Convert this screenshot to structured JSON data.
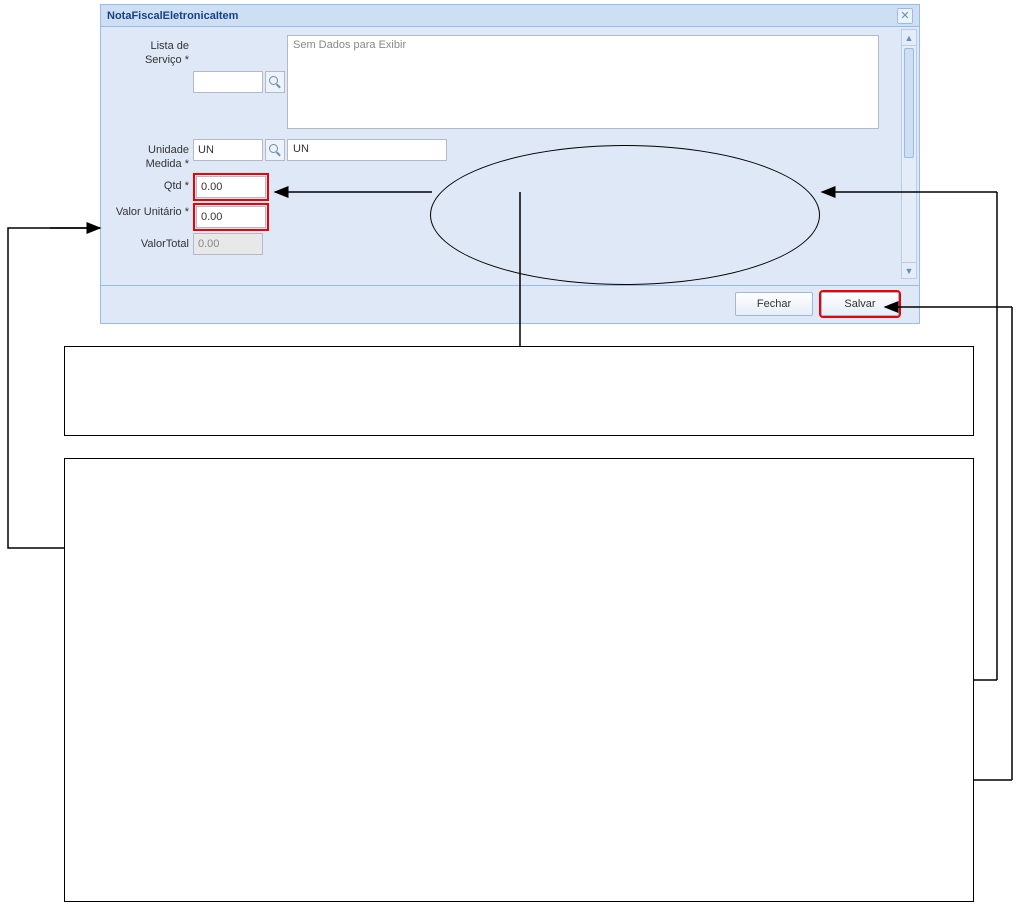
{
  "window": {
    "title": "NotaFiscalEletronicaItem"
  },
  "form": {
    "lista_servico": {
      "label": "Lista de Serviço *",
      "value": "",
      "display": "Sem Dados para Exibir"
    },
    "unidade_medida": {
      "label": "Unidade Medida *",
      "value": "UN",
      "display": "UN"
    },
    "qtd": {
      "label": "Qtd *",
      "value": "0.00"
    },
    "valor_unitario": {
      "label": "Valor Unitário *",
      "value": "0.00"
    },
    "valor_total": {
      "label": "ValorTotal",
      "value": "0.00"
    }
  },
  "buttons": {
    "fechar": "Fechar",
    "salvar": "Salvar"
  }
}
